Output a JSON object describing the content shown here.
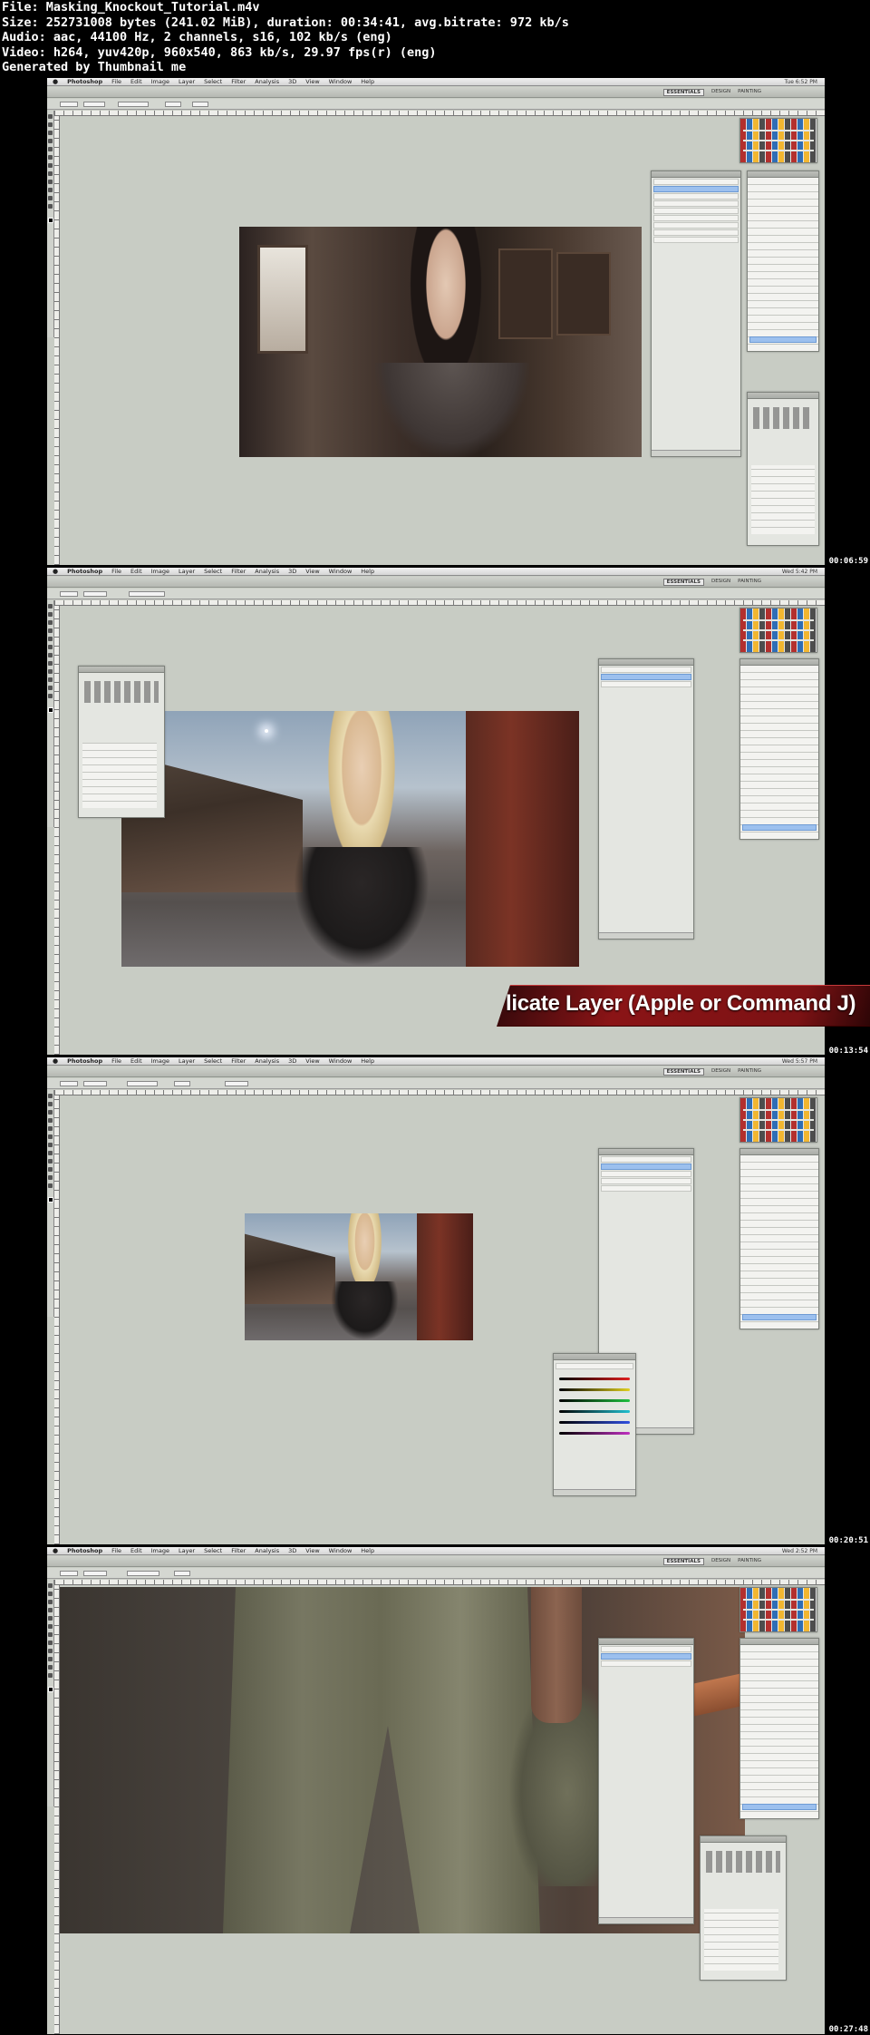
{
  "header": {
    "file": "File: Masking_Knockout_Tutorial.m4v",
    "size": "Size: 252731008 bytes (241.02 MiB), duration: 00:34:41, avg.bitrate: 972 kb/s",
    "audio": "Audio: aac, 44100 Hz, 2 channels, s16, 102 kb/s (eng)",
    "video": "Video: h264, yuv420p, 960x540, 863 kb/s, 29.97 fps(r) (eng)",
    "generator": "Generated by Thumbnail me"
  },
  "app": {
    "name": "Photoshop",
    "menus": [
      "File",
      "Edit",
      "Image",
      "Layer",
      "Select",
      "Filter",
      "Analysis",
      "3D",
      "View",
      "Window",
      "Help"
    ],
    "workspaces": [
      "ESSENTIALS",
      "DESIGN",
      "PAINTING"
    ]
  },
  "frames": [
    {
      "timestamp": "00:06:59",
      "clock": "Tue 6:52 PM"
    },
    {
      "timestamp": "00:13:54",
      "clock": "Wed 5:42 PM"
    },
    {
      "timestamp": "00:20:51",
      "clock": "Wed 5:57 PM"
    },
    {
      "timestamp": "00:27:48",
      "clock": "Wed 2:52 PM"
    }
  ],
  "overlay": {
    "caption": "licate Layer (Apple or Command J)"
  },
  "colors": {
    "ui_gray": "#c8ccc4",
    "caption_red": "#8a1416",
    "layer_selected": "#9cc0ee"
  }
}
